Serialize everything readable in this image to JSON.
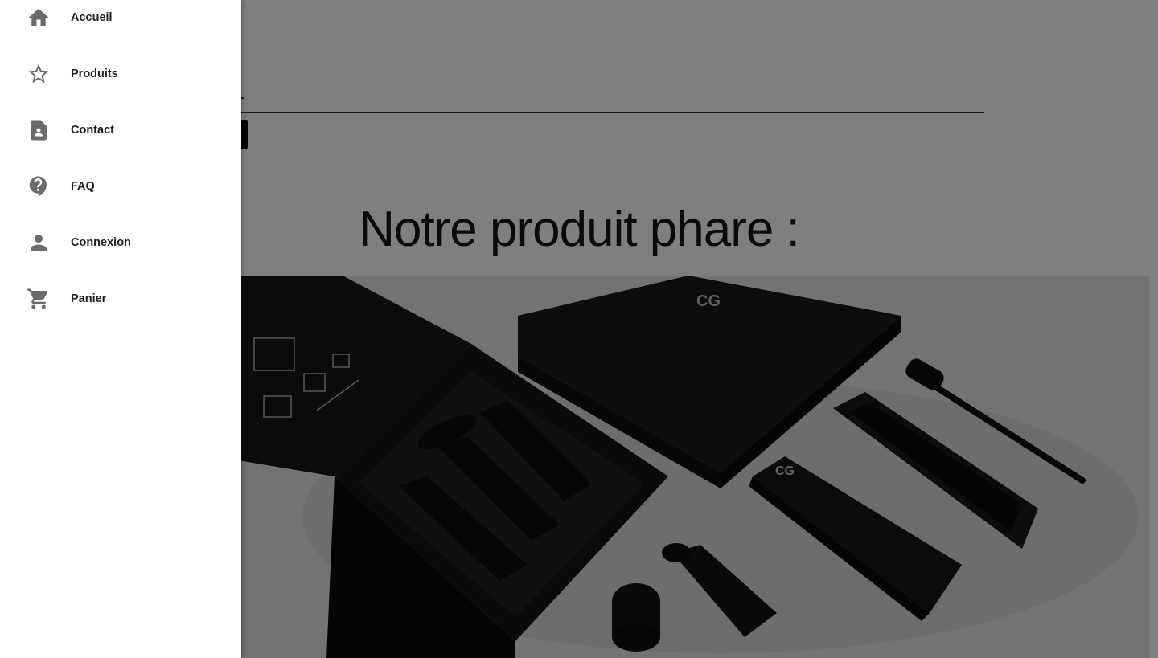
{
  "main": {
    "headline": "Notre produit phare :"
  },
  "drawer": {
    "items": [
      {
        "label": "Accueil",
        "icon": "home-icon"
      },
      {
        "label": "Produits",
        "icon": "star-outline-icon"
      },
      {
        "label": "Contact",
        "icon": "contact-card-icon"
      },
      {
        "label": "FAQ",
        "icon": "help-icon"
      },
      {
        "label": "Connexion",
        "icon": "person-icon"
      },
      {
        "label": "Panier",
        "icon": "cart-icon"
      }
    ]
  },
  "colors": {
    "icon": "#6b6b6b",
    "scrim": "rgba(0,0,0,0.5)",
    "drawer_bg": "#ffffff"
  },
  "hero_image": {
    "logo_text": "CG"
  }
}
